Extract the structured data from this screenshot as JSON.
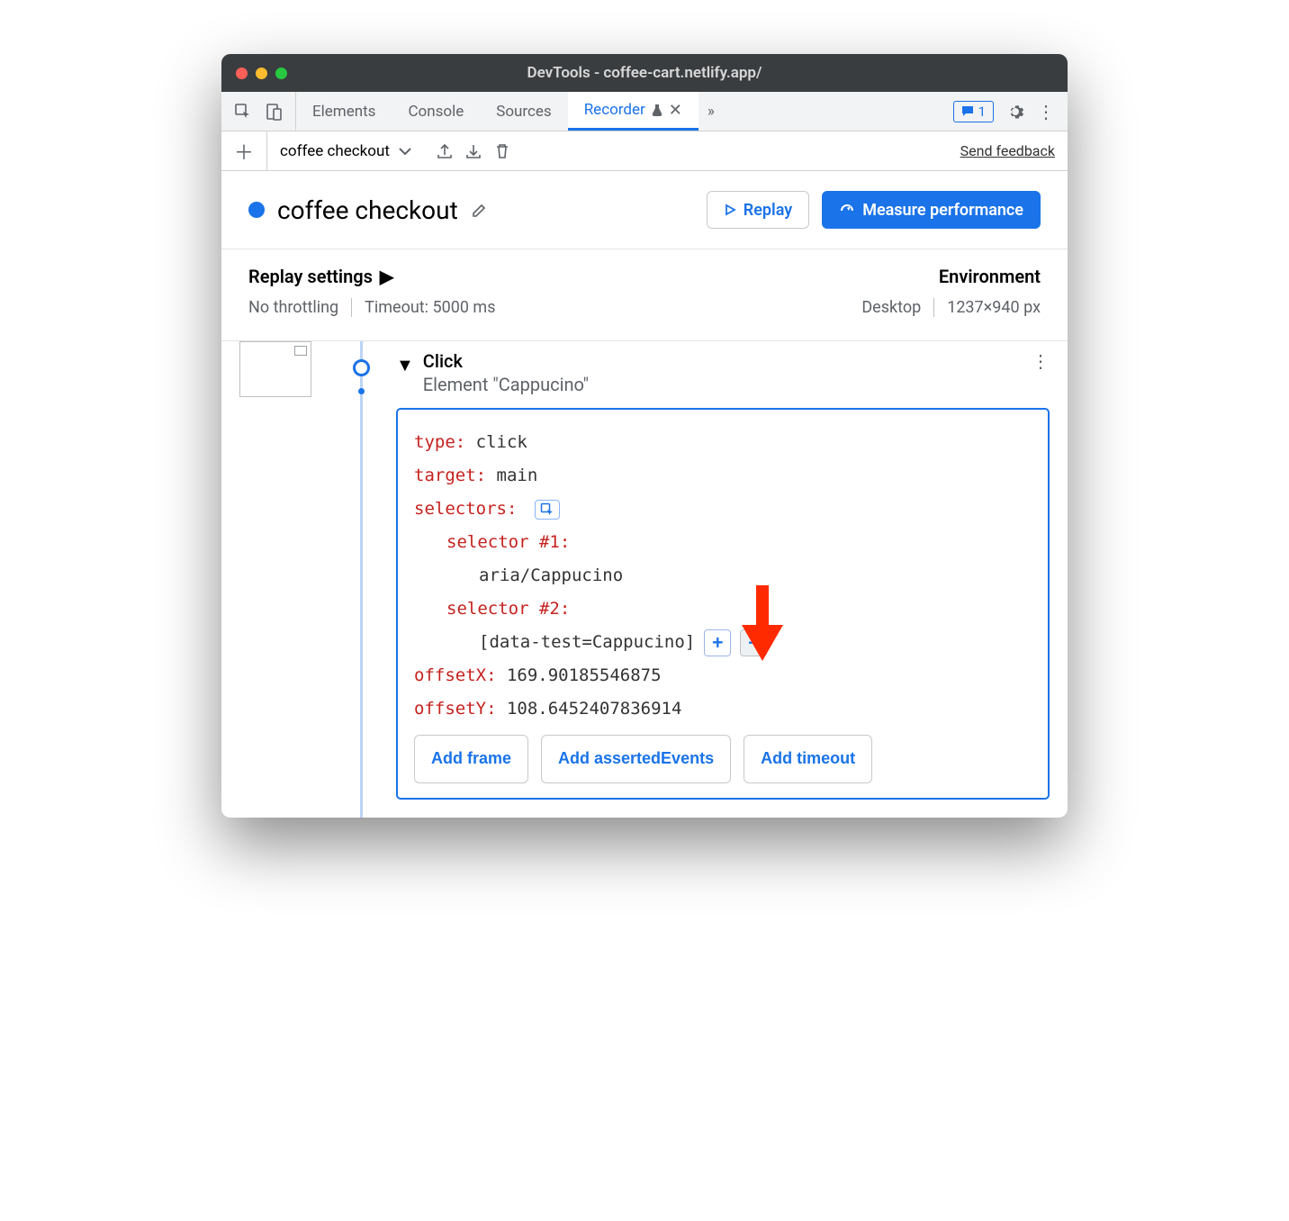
{
  "window": {
    "title": "DevTools - coffee-cart.netlify.app/"
  },
  "tabs": {
    "items": [
      "Elements",
      "Console",
      "Sources",
      "Recorder"
    ],
    "activeIndex": 3,
    "issuesCount": "1"
  },
  "toolbar": {
    "recordingName": "coffee checkout",
    "sendFeedback": "Send feedback"
  },
  "header": {
    "title": "coffee checkout",
    "replayLabel": "Replay",
    "measureLabel": "Measure performance"
  },
  "settings": {
    "replayTitle": "Replay settings",
    "throttling": "No throttling",
    "timeout": "Timeout: 5000 ms",
    "envTitle": "Environment",
    "device": "Desktop",
    "dimensions": "1237×940 px"
  },
  "step": {
    "kind": "Click",
    "subtitle": "Element \"Cappucino\"",
    "fields": {
      "typeLabel": "type",
      "typeValue": "click",
      "targetLabel": "target",
      "targetValue": "main",
      "selectorsLabel": "selectors",
      "selector1Label": "selector #1",
      "selector1Value": "aria/Cappucino",
      "selector2Label": "selector #2",
      "selector2Value": "[data-test=Cappucino]",
      "offsetXLabel": "offsetX",
      "offsetXValue": "169.90185546875",
      "offsetYLabel": "offsetY",
      "offsetYValue": "108.6452407836914"
    },
    "addFrame": "Add frame",
    "addAssertedEvents": "Add assertedEvents",
    "addTimeout": "Add timeout"
  }
}
